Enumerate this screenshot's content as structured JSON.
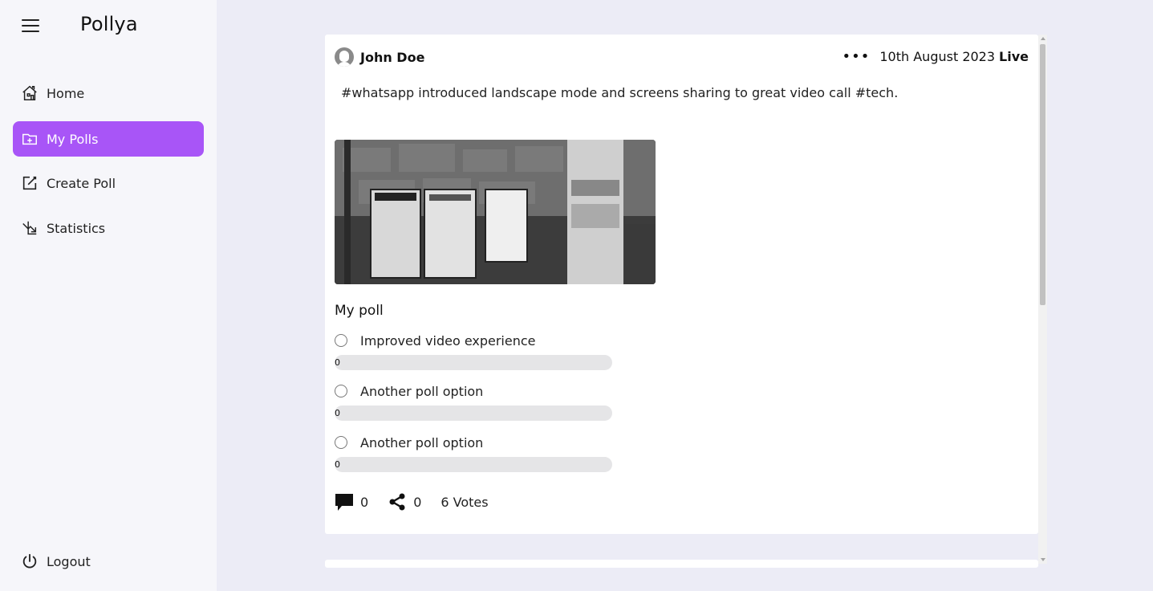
{
  "sidebar": {
    "brand": "Pollya",
    "items": [
      {
        "label": "Home",
        "icon": "home-icon",
        "active": false
      },
      {
        "label": "My Polls",
        "icon": "folder-plus-icon",
        "active": true
      },
      {
        "label": "Create Poll",
        "icon": "edit-icon",
        "active": false
      },
      {
        "label": "Statistics",
        "icon": "chart-arrow-icon",
        "active": false
      }
    ],
    "logout": "Logout",
    "accent_color": "#a855f7"
  },
  "post": {
    "author": "John Doe",
    "date": "10th August 2023",
    "status": "Live",
    "text": "#whatsapp introduced landscape mode and screens sharing to great video call #tech.",
    "poll": {
      "title": "My poll",
      "options": [
        {
          "label": "Improved video experience",
          "count": "0",
          "percent": 0
        },
        {
          "label": "Another poll option",
          "count": "0",
          "percent": 0
        },
        {
          "label": "Another poll option",
          "count": "0",
          "percent": 0
        }
      ]
    },
    "comments": "0",
    "shares": "0",
    "votes": "6 Votes"
  }
}
